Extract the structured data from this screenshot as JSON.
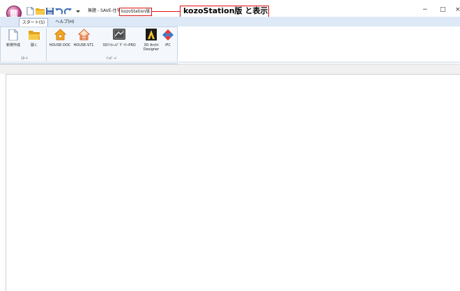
{
  "window": {
    "title": "無題 - SAVE-住宅",
    "title_highlight": "kozoStation版",
    "callout_text": "kozoStation版 と表示",
    "minimize_glyph": "−",
    "maximize_glyph": "□",
    "close_glyph": "×"
  },
  "quick_access": [
    "new-icon",
    "open-folder-icon",
    "save-icon",
    "undo-icon",
    "redo-icon",
    "dropdown-icon"
  ],
  "tabs": [
    {
      "label": "スタート(S)",
      "active": true
    },
    {
      "label": "ヘルプ(H)",
      "active": false
    }
  ],
  "ribbon": {
    "groups": [
      {
        "label": "ｽﾀｰﾄ",
        "buttons": [
          {
            "label": "新規作成",
            "icon": "new-document-icon"
          },
          {
            "label": "開く",
            "icon": "open-folder-icon"
          }
        ]
      },
      {
        "label": "ｲﾝﾎﾟｰﾄ",
        "buttons": [
          {
            "label": "HOUSE-DOC",
            "icon": "house-doc-icon"
          },
          {
            "label": "HOUSE-ST1",
            "icon": "house-st1-icon"
          },
          {
            "label": "3DﾏｲﾎｰﾑﾃﾞｻﾞｲﾅｰPRO",
            "icon": "3d-myhome-designer-icon"
          },
          {
            "label_line1": "3D Archi",
            "label_line2": "Designer",
            "icon": "3d-archi-designer-icon"
          },
          {
            "label": "IFC",
            "icon": "ifc-icon"
          }
        ]
      }
    ]
  },
  "colors": {
    "accent_red": "#e01010",
    "ribbon_bg": "#f4f8fc",
    "tab_bar": "#dde9f6"
  }
}
